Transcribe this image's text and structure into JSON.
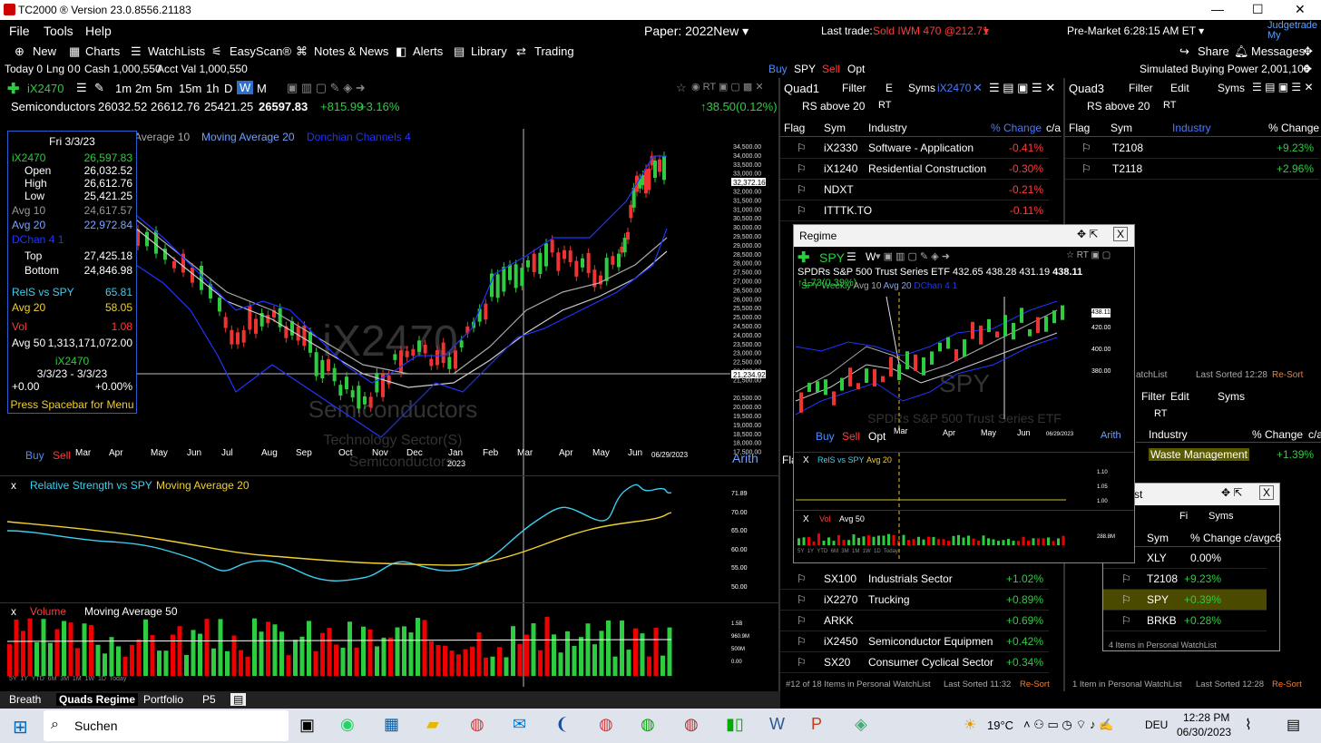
{
  "window": {
    "title": "TC2000 ® Version 23.0.8556.21183",
    "min": "—",
    "max": "☐",
    "close": "✕"
  },
  "menu": {
    "file": "File",
    "tools": "Tools",
    "help": "Help",
    "paper": "Paper: 2022New ▾",
    "last_trade_label": "Last trade:",
    "last_trade": "Sold IWM 470 @212.71",
    "last_trade_arrow": "▾",
    "premarket": "Pre-Market 6:28:15 AM ET ▾",
    "judgetrade": "Judgetrade",
    "myservices": "My Services"
  },
  "toolbar": {
    "new": "New",
    "charts": "Charts",
    "watchlists": "WatchLists",
    "easyscan": "EasyScan®",
    "notes": "Notes & News",
    "alerts": "Alerts",
    "library": "Library",
    "trading": "Trading",
    "share": "Share",
    "messages": "Messages"
  },
  "status": {
    "today": "Today 0",
    "lng": "Lng 0",
    "zero": "0",
    "cash": "Cash 1,000,550",
    "acct": "Acct Val 1,000,550",
    "buy": "Buy",
    "sym": "SPY",
    "sell": "Sell",
    "opt": "Opt",
    "sbp": "Simulated Buying Power 2,001,100"
  },
  "chart": {
    "symbol": "iX2470",
    "intervals": [
      "1m",
      "2m",
      "5m",
      "15m",
      "1h",
      "D",
      "W",
      "M"
    ],
    "active_interval": "W",
    "name": "Semiconductors",
    "open": "26032.52",
    "high": "26612.76",
    "low": "25421.25",
    "close": "26597.83",
    "change": "+815.99",
    "pct": "+3.16%",
    "right_change": "↑38.50(0.12%)",
    "legend_avg10": "Average 10",
    "legend_avg20": "Moving Average 20",
    "legend_dchan": "Donchian Channels 4",
    "watermark1": "iX2470",
    "watermark2": "Semiconductors",
    "watermark3": "Technology Sector(S)",
    "watermark4": "Semiconductors",
    "months": [
      "Mar",
      "Apr",
      "May",
      "Jun",
      "Jul",
      "Aug",
      "Sep",
      "Oct",
      "Nov",
      "Dec",
      "Jan",
      "Feb",
      "Mar",
      "Apr",
      "May",
      "Jun"
    ],
    "year": "2023",
    "date_right": "06/29/2023",
    "arith": "Arith",
    "buy": "Buy",
    "sell": "Sell",
    "prices": [
      "34,500.00",
      "34,000.00",
      "33,500.00",
      "33,000.00",
      "32,372.16",
      "32,000.00",
      "31,500.00",
      "31,000.00",
      "30,500.00",
      "30,000.00",
      "29,500.00",
      "29,000.00",
      "28,500.00",
      "28,000.00",
      "27,500.00",
      "27,000.00",
      "26,500.00",
      "26,000.00",
      "25,500.00",
      "25,000.00",
      "24,500.00",
      "24,000.00",
      "23,500.00",
      "23,000.00",
      "22,500.00",
      "22,000.00",
      "21,500.00",
      "21,234.92",
      "20,500.00",
      "20,000.00",
      "19,500.00",
      "19,000.00",
      "18,500.00",
      "18,000.00",
      "17,500.00"
    ],
    "crosshair_price": "21,234.92",
    "last_price_tag": "32,372.16"
  },
  "databox": {
    "date": "Fri 3/3/23",
    "sym": "iX2470",
    "symval": "26,597.83",
    "open_l": "Open",
    "open": "26,032.52",
    "high_l": "High",
    "high": "26,612.76",
    "low_l": "Low",
    "low": "25,421.25",
    "avg10_l": "Avg 10",
    "avg10": "24,617.57",
    "avg20_l": "Avg 20",
    "avg20": "22,972.84",
    "dchan": "DChan 4 1",
    "top_l": "Top",
    "top": "27,425.18",
    "bottom_l": "Bottom",
    "bottom": "24,846.98",
    "rel_l": "RelS vs SPY",
    "rel": "65.81",
    "avg20b_l": "Avg 20",
    "avg20b": "58.05",
    "vol_l": "Vol",
    "vol": "1.08",
    "avg50_l": "Avg 50",
    "avg50": "1,313,171,072.00",
    "sym2": "iX2470",
    "range": "3/3/23 - 3/3/23",
    "chg1": "+0.00",
    "chg2": "+0.00%",
    "menu": "Press Spacebar for Menu"
  },
  "rs_pane": {
    "title": "Relative Strength vs SPY",
    "ma": "Moving Average 20",
    "ticks": [
      "71.89",
      "70.00",
      "65.00",
      "60.00",
      "55.00",
      "50.00"
    ]
  },
  "vol_pane": {
    "title": "Volume",
    "ma": "Moving Average 50",
    "ticks": [
      "1.5B",
      "960.9M",
      "500M",
      "0.00"
    ],
    "timeframes": [
      "5Y",
      "1Y",
      "YTD",
      "6M",
      "3M",
      "1M",
      "1W",
      "1D",
      "Today"
    ]
  },
  "quad1": {
    "title": "Quad1",
    "filter": "Filter",
    "e": "E",
    "syms": "Syms",
    "sym": "iX2470",
    "filtername": "RS above 20",
    "rt": "RT",
    "cols": [
      "Flag",
      "Sym",
      "Industry",
      "% Change",
      "c/a"
    ],
    "rows": [
      {
        "sym": "iX2330",
        "ind": "Software - Application",
        "chg": "-0.41%"
      },
      {
        "sym": "iX1240",
        "ind": "Residential Construction",
        "chg": "-0.30%"
      },
      {
        "sym": "NDXT",
        "ind": "",
        "chg": "-0.21%"
      },
      {
        "sym": "ITTTK.TO",
        "ind": "",
        "chg": "-0.11%"
      }
    ],
    "rows2": [
      {
        "sym": "SX100",
        "ind": "Industrials Sector",
        "chg": "+1.02%"
      },
      {
        "sym": "iX2270",
        "ind": "Trucking",
        "chg": "+0.89%"
      },
      {
        "sym": "ARKK",
        "ind": "",
        "chg": "+0.69%"
      },
      {
        "sym": "iX2450",
        "ind": "Semiconductor Equipmen",
        "chg": "+0.42%"
      },
      {
        "sym": "SX20",
        "ind": "Consumer Cyclical Sector",
        "chg": "+0.34%"
      }
    ],
    "footer": "#12 of 18 Items in Personal WatchList",
    "sorted": "Last Sorted 11:32",
    "resort": "Re-Sort",
    "flag_left": "Fla"
  },
  "quad3": {
    "title": "Quad3",
    "filter": "Filter",
    "edit": "Edit",
    "syms": "Syms",
    "filtername": "RS above 20",
    "rt": "RT",
    "cols": [
      "Flag",
      "Sym",
      "Industry",
      "% Change"
    ],
    "rows": [
      {
        "sym": "T2108",
        "chg": "+9.23%"
      },
      {
        "sym": "T2118",
        "chg": "+2.96%"
      }
    ],
    "mid_footer": "atchList",
    "mid_sorted": "Last Sorted 12:28",
    "mid_resort": "Re-Sort",
    "mid_filter": "Filter",
    "mid_edit": "Edit",
    "mid_syms": "Syms",
    "mid_rt": "RT",
    "mid_cols": [
      "Industry",
      "% Change",
      "c/a"
    ],
    "mid_row": {
      "ind": "Waste Management",
      "chg": "+1.39%"
    },
    "footer": "1 Item in Personal WatchList",
    "sorted": "Last Sorted 12:28",
    "resort": "Re-Sort"
  },
  "mini": {
    "title": "st",
    "fi": "Fi",
    "syms": "Syms",
    "cols": [
      "Sym",
      "% Change",
      "c/avgc6"
    ],
    "rows": [
      {
        "sym": "XLY",
        "chg": "0.00%"
      },
      {
        "sym": "T2108",
        "chg": "+9.23%"
      },
      {
        "sym": "SPY",
        "chg": "+0.39%"
      },
      {
        "sym": "BRKB",
        "chg": "+0.28%"
      }
    ],
    "footer": "4 Items in Personal WatchList"
  },
  "regime": {
    "title": "Regime",
    "sym": "SPY",
    "interval": "W",
    "name": "SPDRs S&P 500 Trust Series ETF",
    "open": "432.65",
    "high": "438.28",
    "low": "431.19",
    "close": "438.11",
    "chg": "↑1.73(0.39%)",
    "legend1": "SPY Weekly",
    "legend2": "Avg 10",
    "legend3": "Avg 20",
    "legend4": "DChan 4 1",
    "watermark1": "SPY",
    "watermark2": "SPDRs S&P 500 Trust Series ETF",
    "months": [
      "Mar",
      "Apr",
      "May",
      "Jun"
    ],
    "date": "06/29/2023",
    "arith": "Arith",
    "buy": "Buy",
    "sell": "Sell",
    "opt": "Opt",
    "rs": "RelS vs SPY",
    "rs_avg": "Avg 20",
    "vol": "Vol",
    "vol_avg": "Avg 50",
    "ticks": [
      "438.11",
      "420.00",
      "400.00",
      "380.00"
    ],
    "rs_ticks": [
      "1.10",
      "1.05",
      "1.00"
    ],
    "vol_tick": "288.8M",
    "timeframes": [
      "5Y",
      "1Y",
      "YTD",
      "6M",
      "3M",
      "1M",
      "1W",
      "1D",
      "Today"
    ]
  },
  "tabs": [
    "Breath",
    "Quads Regime",
    "Portfolio",
    "P5"
  ],
  "taskbar": {
    "search": "Suchen",
    "weather": "19°C",
    "lang": "DEU",
    "time": "12:28 PM",
    "date": "06/30/2023"
  }
}
